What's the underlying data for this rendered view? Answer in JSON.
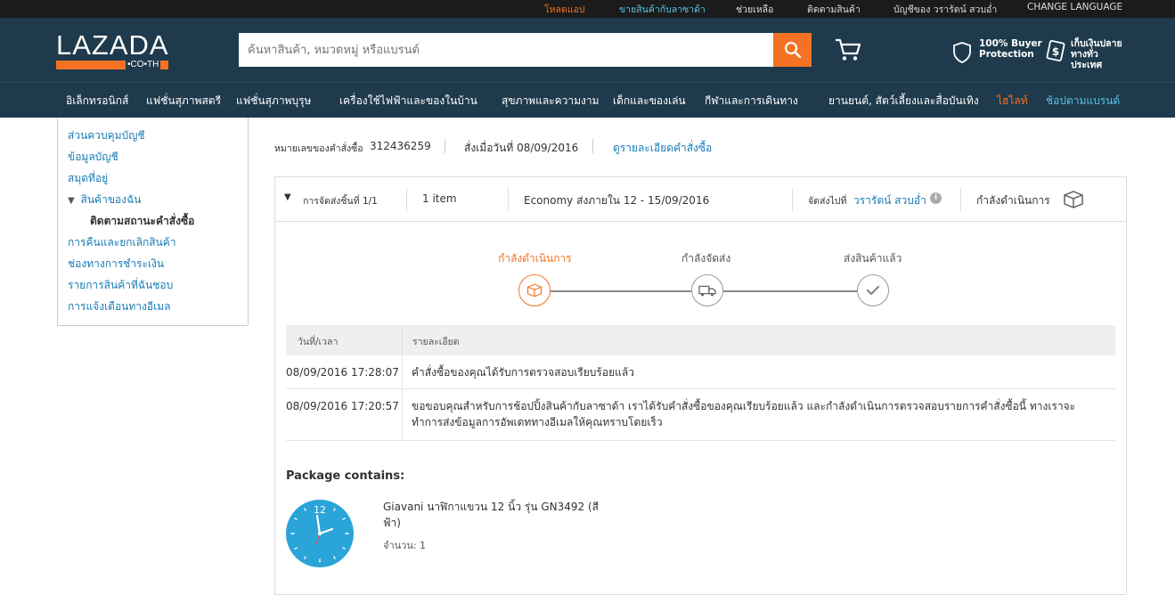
{
  "topbar": {
    "download_app": "โหลดแอป",
    "sell_on_lazada": "ขายสินค้ากับลาซาด้า",
    "help": "ช่วยเหลือ",
    "track_order": "ติดตามสินค้า",
    "account": "บัญชีของ วรารัตน์ สวบอ่ำ",
    "change_language": "CHANGE LANGUAGE"
  },
  "header": {
    "logo_text": "LAZADA",
    "logo_sub": "•CO•TH",
    "search_placeholder": "ค้นหาสินค้า, หมวดหมู่ หรือแบรนด์",
    "buyer_protection": "100% Buyer\nProtection",
    "cod": "เก็บเงินปลาย\nทางทั่ว\nประเทศ",
    "colors": {
      "brand": "#f57224",
      "header_bg": "#1e3a4c"
    }
  },
  "categories": [
    "อิเล็กทรอนิกส์",
    "แฟชั่นสุภาพสตรี",
    "แฟชั่นสุภาพบุรุษ",
    "เครื่องใช้ไฟฟ้าและของในบ้าน",
    "สุขภาพและความงาม",
    "เด็กและของเล่น",
    "กีฬาและการเดินทาง",
    "ยานยนต์, สัตว์เลี้ยงและสื่อบันเทิง",
    "ไฮไลท์",
    "ช้อปตามแบรนด์"
  ],
  "sidebar": {
    "items": [
      "ส่วนควบคุมบัญชี",
      "ข้อมูลบัญชี",
      "สมุดที่อยู่",
      "สินค้าของฉัน",
      "ติดตามสถานะคำสั่งซื้อ",
      "การคืนและยกเลิกสินค้า",
      "ช่องทางการชำระเงิน",
      "รายการสินค้าที่ฉันชอบ",
      "การแจ้งเตือนทางอีเมล"
    ]
  },
  "order": {
    "number_label": "หมายเลขของคำสั่งซื้อ",
    "number": "312436259",
    "date": "สั่งเมื่อวันที่ 08/09/2016",
    "details_link": "ดูรายละเอียดคำสั่งซื้อ"
  },
  "shipment": {
    "label": "การจัดส่งชิ้นที่ 1/1",
    "items": "1 item",
    "delivery": "Economy ส่งภายใน 12 - 15/09/2016",
    "ship_to_label": "จัดส่งไปที่",
    "ship_to_name": "วรารัตน์ สวบอ่ำ",
    "status": "กำลังดำเนินการ"
  },
  "progress": {
    "steps": [
      "กำลังดำเนินการ",
      "กำลังจัดส่ง",
      "ส่งสินค้าแล้ว"
    ],
    "current_step": 1
  },
  "history": {
    "col_datetime": "วันที่/เวลา",
    "col_details": "รายละเอียด",
    "rows": [
      {
        "datetime": "08/09/2016 17:28:07",
        "detail": "คำสั่งซื้อของคุณได้รับการตรวจสอบเรียบร้อยแล้ว"
      },
      {
        "datetime": "08/09/2016 17:20:57",
        "detail": "ขอขอบคุณสำหรับการช้อปปิ้งสินค้ากับลาซาด้า เราได้รับคำสั่งซื้อของคุณเรียบร้อยแล้ว และกำลังดำเนินการตรวจสอบรายการคำสั่งซื้อนี้ ทางเราจะทำการส่งข้อมูลการอัพเดททางอีเมลให้คุณทราบโดยเร็ว"
      }
    ]
  },
  "package": {
    "title": "Package contains:",
    "product_name": "Giavani นาฬิกาแขวน 12 นิ้ว รุ่น GN3492 (สีฟ้า)",
    "quantity": "จำนวน: 1",
    "clock_number": "12"
  }
}
